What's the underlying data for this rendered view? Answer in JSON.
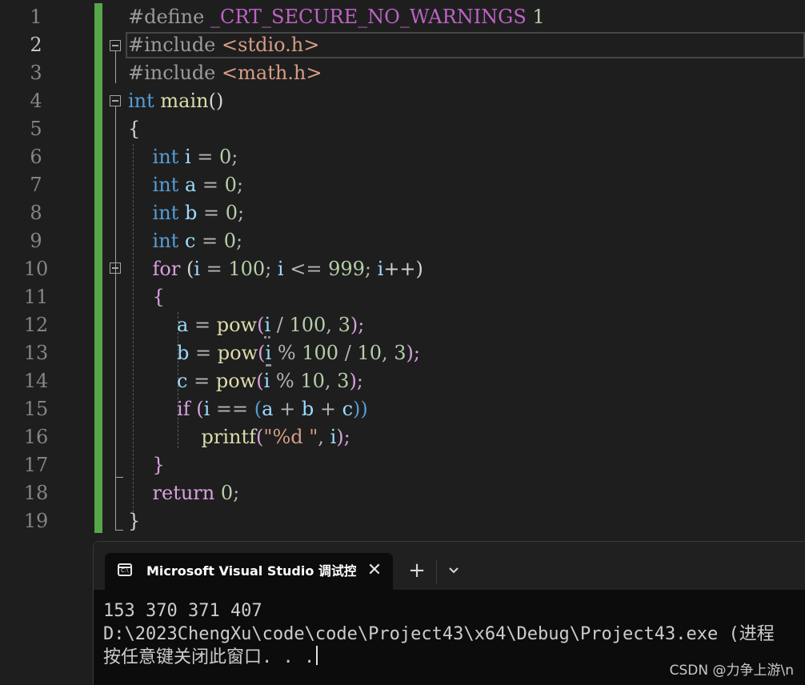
{
  "editor": {
    "line_numbers": [
      "1",
      "2",
      "3",
      "4",
      "5",
      "6",
      "7",
      "8",
      "9",
      "10",
      "11",
      "12",
      "13",
      "14",
      "15",
      "16",
      "17",
      "18",
      "19"
    ],
    "current_line": "2",
    "code_lines": [
      [
        {
          "t": "#define ",
          "c": "pp"
        },
        {
          "t": "_CRT_SECURE_NO_WARNINGS",
          "c": "macro"
        },
        {
          "t": " ",
          "c": "pp"
        },
        {
          "t": "1",
          "c": "num"
        }
      ],
      [
        {
          "t": "#include ",
          "c": "pp"
        },
        {
          "t": "<stdio.h>",
          "c": "str"
        }
      ],
      [
        {
          "t": "#include ",
          "c": "pp"
        },
        {
          "t": "<math.h>",
          "c": "str"
        }
      ],
      [
        {
          "t": "int",
          "c": "kw"
        },
        {
          "t": " ",
          "c": ""
        },
        {
          "t": "main",
          "c": "fn"
        },
        {
          "t": "()",
          "c": "brace"
        }
      ],
      [
        {
          "t": "{",
          "c": "brace"
        }
      ],
      [
        {
          "t": "    ",
          "c": ""
        },
        {
          "t": "int",
          "c": "kw"
        },
        {
          "t": " ",
          "c": ""
        },
        {
          "t": "i",
          "c": "var"
        },
        {
          "t": " = ",
          "c": "op"
        },
        {
          "t": "0",
          "c": "num"
        },
        {
          "t": ";",
          "c": "op"
        }
      ],
      [
        {
          "t": "    ",
          "c": ""
        },
        {
          "t": "int",
          "c": "kw"
        },
        {
          "t": " ",
          "c": ""
        },
        {
          "t": "a",
          "c": "var"
        },
        {
          "t": " = ",
          "c": "op"
        },
        {
          "t": "0",
          "c": "num"
        },
        {
          "t": ";",
          "c": "op"
        }
      ],
      [
        {
          "t": "    ",
          "c": ""
        },
        {
          "t": "int",
          "c": "kw"
        },
        {
          "t": " ",
          "c": ""
        },
        {
          "t": "b",
          "c": "var"
        },
        {
          "t": " = ",
          "c": "op"
        },
        {
          "t": "0",
          "c": "num"
        },
        {
          "t": ";",
          "c": "op"
        }
      ],
      [
        {
          "t": "    ",
          "c": ""
        },
        {
          "t": "int",
          "c": "kw"
        },
        {
          "t": " ",
          "c": ""
        },
        {
          "t": "c",
          "c": "var"
        },
        {
          "t": " = ",
          "c": "op"
        },
        {
          "t": "0",
          "c": "num"
        },
        {
          "t": ";",
          "c": "op"
        }
      ],
      [
        {
          "t": "    ",
          "c": ""
        },
        {
          "t": "for",
          "c": "ctl"
        },
        {
          "t": " (",
          "c": "brace"
        },
        {
          "t": "i",
          "c": "var"
        },
        {
          "t": " = ",
          "c": "op"
        },
        {
          "t": "100",
          "c": "num"
        },
        {
          "t": "; ",
          "c": "op"
        },
        {
          "t": "i",
          "c": "var"
        },
        {
          "t": " <= ",
          "c": "op"
        },
        {
          "t": "999",
          "c": "num"
        },
        {
          "t": "; ",
          "c": "op"
        },
        {
          "t": "i",
          "c": "var"
        },
        {
          "t": "++)",
          "c": "brace"
        }
      ],
      [
        {
          "t": "    ",
          "c": ""
        },
        {
          "t": "{",
          "c": "ctl"
        }
      ],
      [
        {
          "t": "        ",
          "c": ""
        },
        {
          "t": "a",
          "c": "var"
        },
        {
          "t": " = ",
          "c": "op"
        },
        {
          "t": "pow",
          "c": "fn"
        },
        {
          "t": "(",
          "c": "ctl"
        },
        {
          "t": "i",
          "c": "var squiggle"
        },
        {
          "t": " / ",
          "c": "op"
        },
        {
          "t": "100",
          "c": "num"
        },
        {
          "t": ", ",
          "c": "op"
        },
        {
          "t": "3",
          "c": "num"
        },
        {
          "t": ");",
          "c": "ctl"
        }
      ],
      [
        {
          "t": "        ",
          "c": ""
        },
        {
          "t": "b",
          "c": "var"
        },
        {
          "t": " = ",
          "c": "op"
        },
        {
          "t": "pow",
          "c": "fn"
        },
        {
          "t": "(",
          "c": "ctl"
        },
        {
          "t": "i",
          "c": "var squiggle"
        },
        {
          "t": " % ",
          "c": "op"
        },
        {
          "t": "100",
          "c": "num"
        },
        {
          "t": " / ",
          "c": "op"
        },
        {
          "t": "10",
          "c": "num"
        },
        {
          "t": ", ",
          "c": "op"
        },
        {
          "t": "3",
          "c": "num"
        },
        {
          "t": ");",
          "c": "ctl"
        }
      ],
      [
        {
          "t": "        ",
          "c": ""
        },
        {
          "t": "c",
          "c": "var"
        },
        {
          "t": " = ",
          "c": "op"
        },
        {
          "t": "pow",
          "c": "fn"
        },
        {
          "t": "(",
          "c": "ctl"
        },
        {
          "t": "i",
          "c": "var"
        },
        {
          "t": " % ",
          "c": "op"
        },
        {
          "t": "10",
          "c": "num"
        },
        {
          "t": ", ",
          "c": "op"
        },
        {
          "t": "3",
          "c": "num"
        },
        {
          "t": ");",
          "c": "ctl"
        }
      ],
      [
        {
          "t": "        ",
          "c": ""
        },
        {
          "t": "if",
          "c": "ctl"
        },
        {
          "t": " (",
          "c": "ctl"
        },
        {
          "t": "i",
          "c": "var"
        },
        {
          "t": " == ",
          "c": "op"
        },
        {
          "t": "(",
          "c": "kw"
        },
        {
          "t": "a",
          "c": "var"
        },
        {
          "t": " + ",
          "c": "op"
        },
        {
          "t": "b",
          "c": "var"
        },
        {
          "t": " + ",
          "c": "op"
        },
        {
          "t": "c",
          "c": "var"
        },
        {
          "t": "))",
          "c": "kw"
        }
      ],
      [
        {
          "t": "            ",
          "c": ""
        },
        {
          "t": "printf",
          "c": "fn"
        },
        {
          "t": "(",
          "c": "ctl"
        },
        {
          "t": "\"%d \"",
          "c": "str"
        },
        {
          "t": ", ",
          "c": "op"
        },
        {
          "t": "i",
          "c": "var"
        },
        {
          "t": ");",
          "c": "ctl"
        }
      ],
      [
        {
          "t": "    ",
          "c": ""
        },
        {
          "t": "}",
          "c": "ctl"
        }
      ],
      [
        {
          "t": "    ",
          "c": ""
        },
        {
          "t": "return",
          "c": "ctl"
        },
        {
          "t": " ",
          "c": ""
        },
        {
          "t": "0",
          "c": "num"
        },
        {
          "t": ";",
          "c": "op"
        }
      ],
      [
        {
          "t": "}",
          "c": "brace"
        }
      ]
    ]
  },
  "terminal": {
    "tab_title": "Microsoft Visual Studio 调试控制台",
    "tab_icon_text": "C:\\",
    "close_glyph": "✕",
    "new_tab_glyph": "+",
    "dropdown_glyph": "chevron-down-icon",
    "output_lines": [
      "153 370 371 407",
      "D:\\2023ChengXu\\code\\code\\Project43\\x64\\Debug\\Project43.exe (进程",
      "按任意键关闭此窗口. . ."
    ]
  },
  "watermark": "CSDN @力争上游\\n"
}
